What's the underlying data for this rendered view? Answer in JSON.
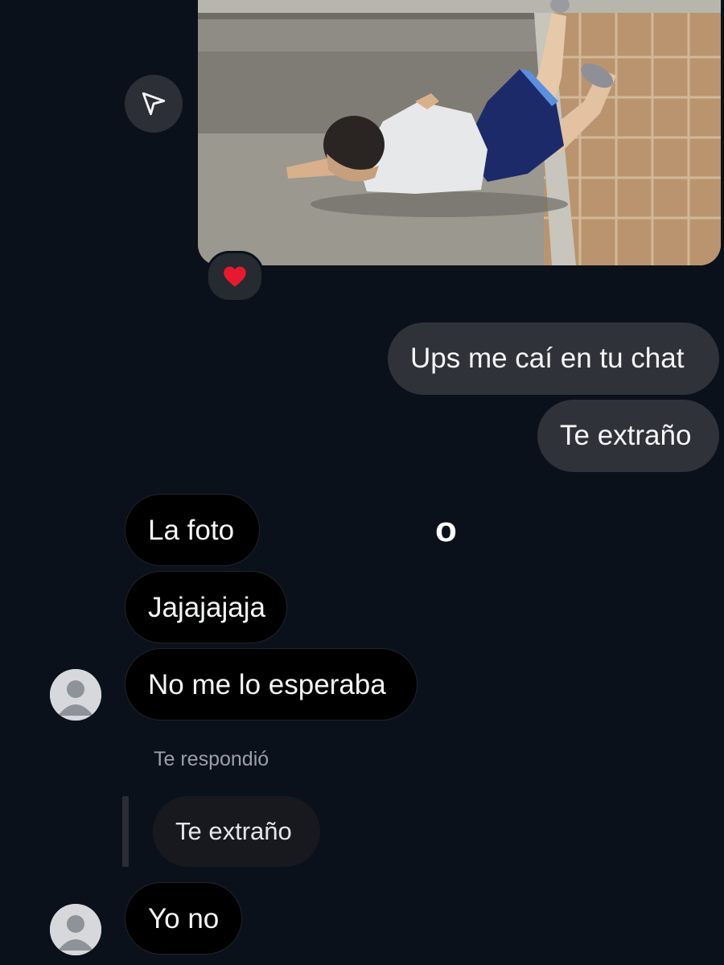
{
  "chat": {
    "media": {
      "description_icon": "shared-photo",
      "reaction": "❤️"
    },
    "sent_messages": [
      {
        "text": "Ups me caí en tu chat"
      },
      {
        "text": "Te extraño"
      }
    ],
    "stray_text": "o",
    "received_messages": [
      {
        "text": "La foto"
      },
      {
        "text": "Jajajajaja"
      },
      {
        "text": "No me lo esperaba"
      }
    ],
    "reply": {
      "label": "Te respondió",
      "quoted_text": "Te extraño",
      "text": "Yo no"
    }
  },
  "colors": {
    "background": "#0b111b",
    "sent_bubble": "#2f3239",
    "received_bubble": "#000000",
    "heart": "#e8192c"
  },
  "icons": [
    "send-share-icon",
    "heart-icon",
    "avatar-icon"
  ]
}
